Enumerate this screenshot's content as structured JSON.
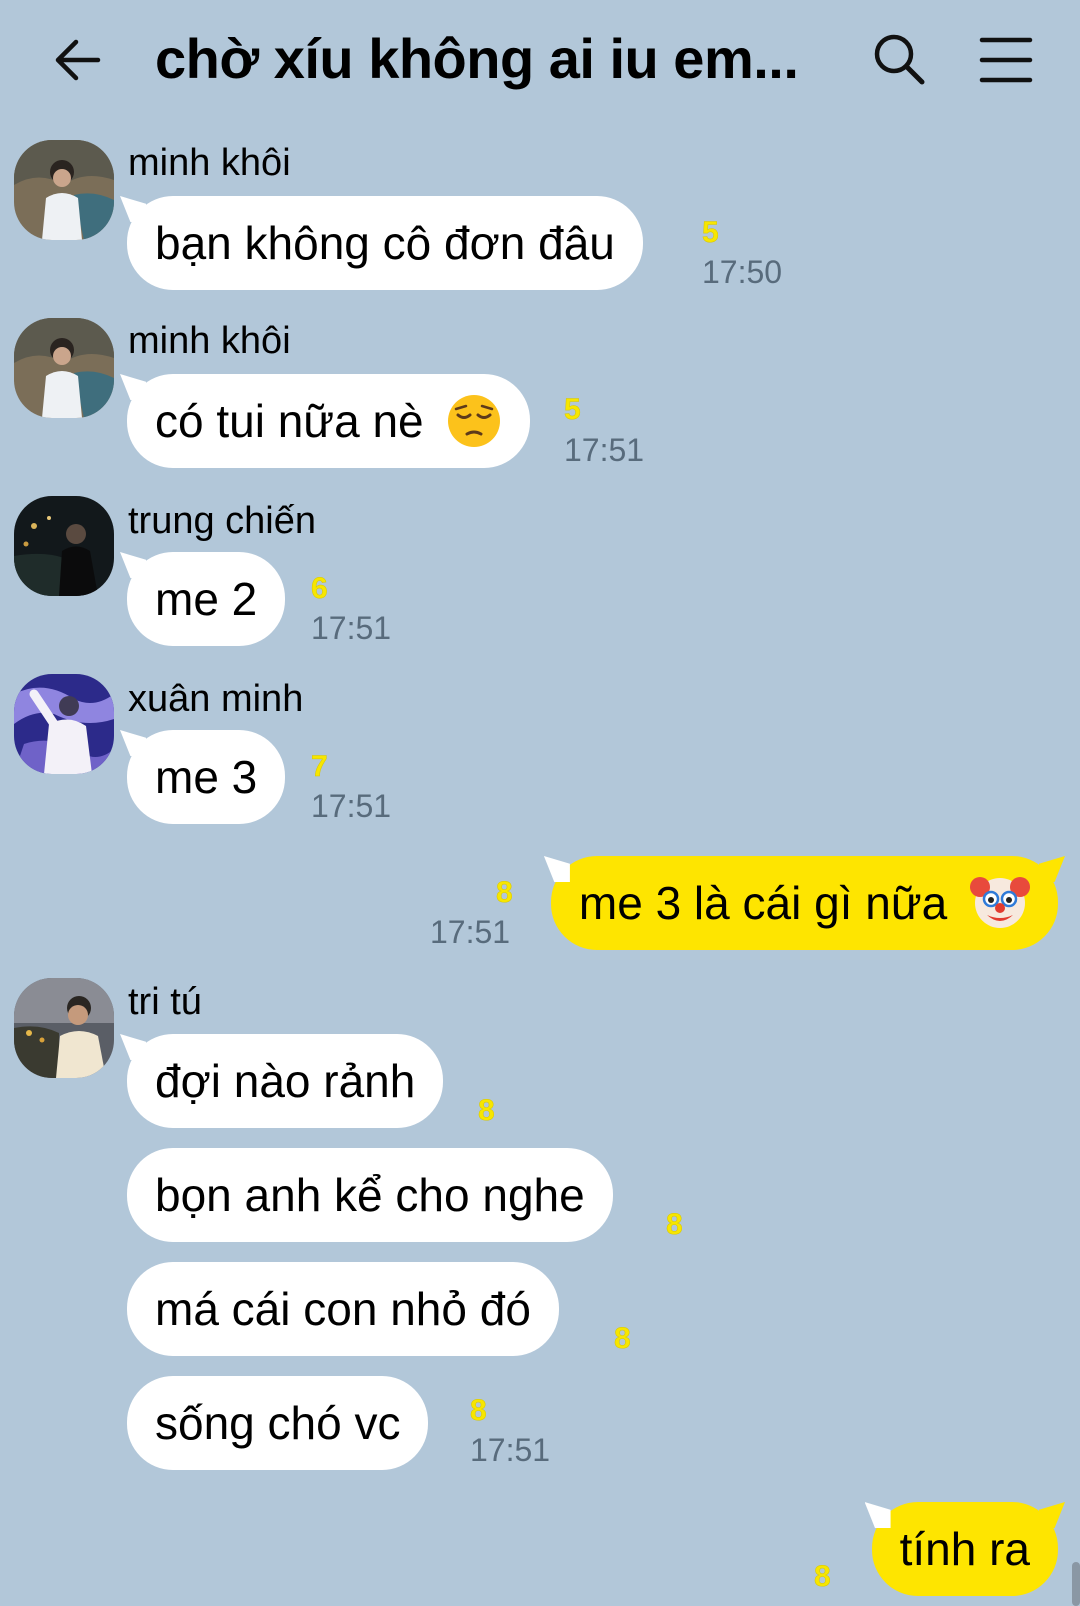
{
  "header": {
    "title": "chờ xíu không ai iu em...",
    "back_icon": "arrow-left-icon",
    "search_icon": "search-icon",
    "menu_icon": "hamburger-menu-icon"
  },
  "colors": {
    "background": "#b2c7d9",
    "incoming_bubble": "#ffffff",
    "outgoing_bubble": "#fee500",
    "unread_count": "#f7e600",
    "timestamp": "#586b7c"
  },
  "messages": [
    {
      "sender": "minh khôi",
      "text": "bạn không cô đơn đâu",
      "unread": "5",
      "time": "17:50"
    },
    {
      "sender": "minh khôi",
      "text": "có tui nữa nè",
      "emoji": "pensive-face-emoji",
      "unread": "5",
      "time": "17:51"
    },
    {
      "sender": "trung chiến",
      "text": "me 2",
      "unread": "6",
      "time": "17:51"
    },
    {
      "sender": "xuân minh",
      "text": "me 3",
      "unread": "7",
      "time": "17:51"
    },
    {
      "sender": "me",
      "text": "me 3 là cái gì nữa",
      "emoji": "clown-face-emoji",
      "unread": "8",
      "time": "17:51"
    },
    {
      "sender": "tri tú",
      "text": "đợi nào rảnh",
      "unread": "8"
    },
    {
      "sender": "tri tú",
      "text": "bọn anh kể cho nghe",
      "unread": "8"
    },
    {
      "sender": "tri tú",
      "text": "má cái con nhỏ đó",
      "unread": "8"
    },
    {
      "sender": "tri tú",
      "text": "sống chó vc",
      "unread": "8",
      "time": "17:51"
    },
    {
      "sender": "me",
      "text": "tính ra",
      "unread": "8"
    }
  ]
}
